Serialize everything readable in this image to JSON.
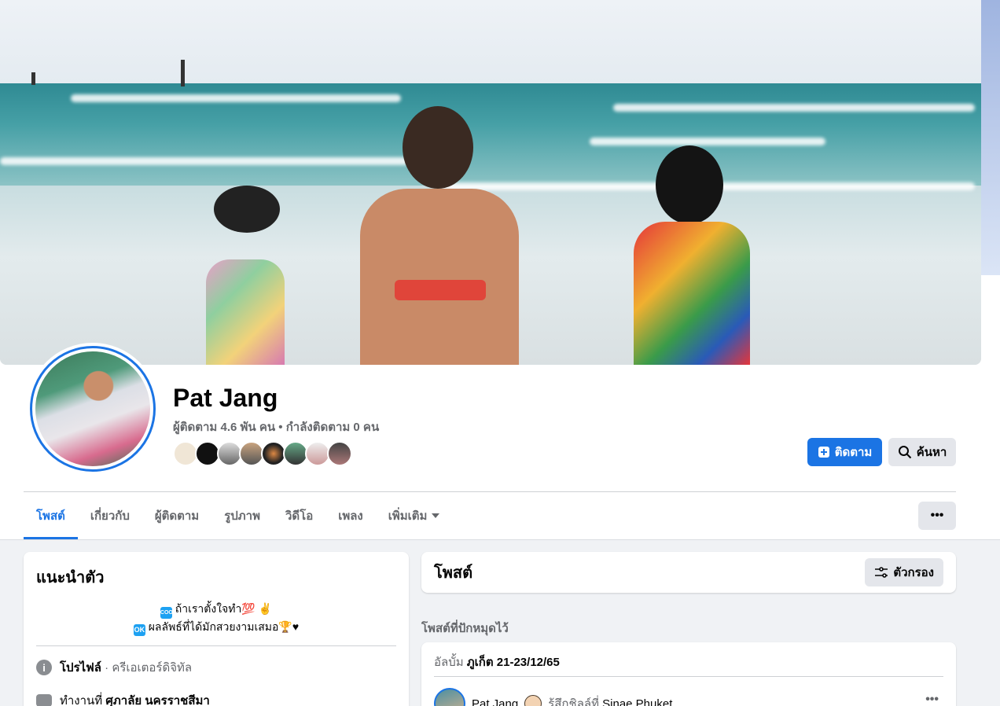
{
  "profile": {
    "name": "Pat Jang",
    "stats": "ผู้ติดตาม 4.6 พัน คน • กำลังติดตาม 0 คน"
  },
  "buttons": {
    "follow": "ติดตาม",
    "search": "ค้นหา",
    "more": "•••"
  },
  "tabs": [
    {
      "label": "โพสต์",
      "active": true
    },
    {
      "label": "เกี่ยวกับ"
    },
    {
      "label": "ผู้ติดตาม"
    },
    {
      "label": "รูปภาพ"
    },
    {
      "label": "วิดีโอ"
    },
    {
      "label": "เพลง"
    },
    {
      "label": "เพิ่มเติม"
    }
  ],
  "intro": {
    "title": "แนะนำตัว",
    "bio_line1_badge": "COOL",
    "bio_line1": "ถ้าเราตั้งใจทำ💯 ✌️",
    "bio_line2_badge": "OK",
    "bio_line2": "ผลลัพธ์ที่ได้มักสวยงามเสมอ🏆♥",
    "profile_label": "โปรไฟล์",
    "profile_type": " · ครีเอเตอร์ดิจิทัล",
    "work_prefix": "ทำงานที่ ",
    "work_place": "ศุภาลัย นครราชสีมา"
  },
  "posts": {
    "title": "โพสต์",
    "filter": "ตัวกรอง",
    "pinned": "โพสต์ที่ปักหมุดไว้",
    "album_prefix": "อัลบั้ม ",
    "album_name": "ภูเก็ต 21-23/12/65",
    "author": "Pat Jang",
    "feeling": "รู้สึกชิลล์ที่ ",
    "location": "Sinae Phuket",
    "menu": "•••"
  },
  "colors": {
    "accent": "#1b74e4",
    "page_bg": "#f0f2f5",
    "muted": "#65676b"
  },
  "icons": {
    "follow": "plus-box-icon",
    "search": "search-icon",
    "filter": "filter-icon",
    "info": "info-icon",
    "work": "briefcase-icon",
    "dropdown": "caret-down-icon"
  }
}
